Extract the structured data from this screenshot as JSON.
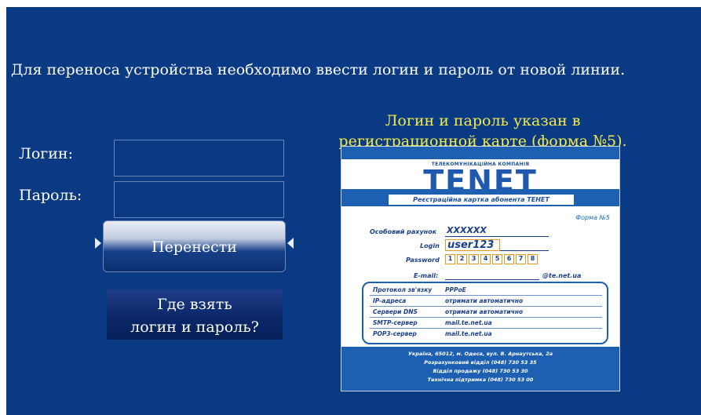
{
  "instruction": "Для переноса устройства необходимо ввести логин и пароль от новой линии.",
  "hint": {
    "line1": "Логин и пароль указан в",
    "line2": "регистрационной карте (форма №5)."
  },
  "form": {
    "login_label": "Логин:",
    "login_value": "",
    "password_label": "Пароль:",
    "password_value": ""
  },
  "buttons": {
    "transfer": "Перенести",
    "help_line1": "Где взять",
    "help_line2": "логин и пароль?"
  },
  "card": {
    "company": "ТЕЛЕКОМУНІКАЦІЙНА КОМПАНІЯ",
    "logo": "TENET",
    "title": "Реєстраційна картка абонента ТЕНЕТ",
    "form_no": "Форма №5",
    "account_label": "Особовий рахунок",
    "account_value": "XXXXXX",
    "login_label": "Login",
    "login_value": "user123",
    "password_label": "Password",
    "password_digits": [
      "1",
      "2",
      "3",
      "4",
      "5",
      "6",
      "7",
      "8"
    ],
    "email_label": "E-mail:",
    "email_domain": "@te.net.ua",
    "info": [
      {
        "label": "Протокол зв'язку",
        "value": "PPPoE"
      },
      {
        "label": "IP-адреса",
        "value": "отримати автоматично"
      },
      {
        "label": "Сервери DNS",
        "value": "отримати автоматично"
      },
      {
        "label": "SMTP-сервер",
        "value": "mail.te.net.ua"
      },
      {
        "label": "POP3-сервер",
        "value": "mail.te.net.ua"
      }
    ],
    "footer": [
      "Україна, 65012, м. Одеса, вул. В. Арнаутська, 2а",
      "Розрахунковий відділ (048) 730 53 35",
      "Відділ продажу (048) 730 53 30",
      "Технічна підтримка (048) 730 53 00"
    ]
  },
  "colors": {
    "background": "#0b3a84",
    "hint_text": "#f2ea4a",
    "text": "#ffffff",
    "card_blue": "#1d5fb0",
    "card_accent": "#e39a1f"
  }
}
